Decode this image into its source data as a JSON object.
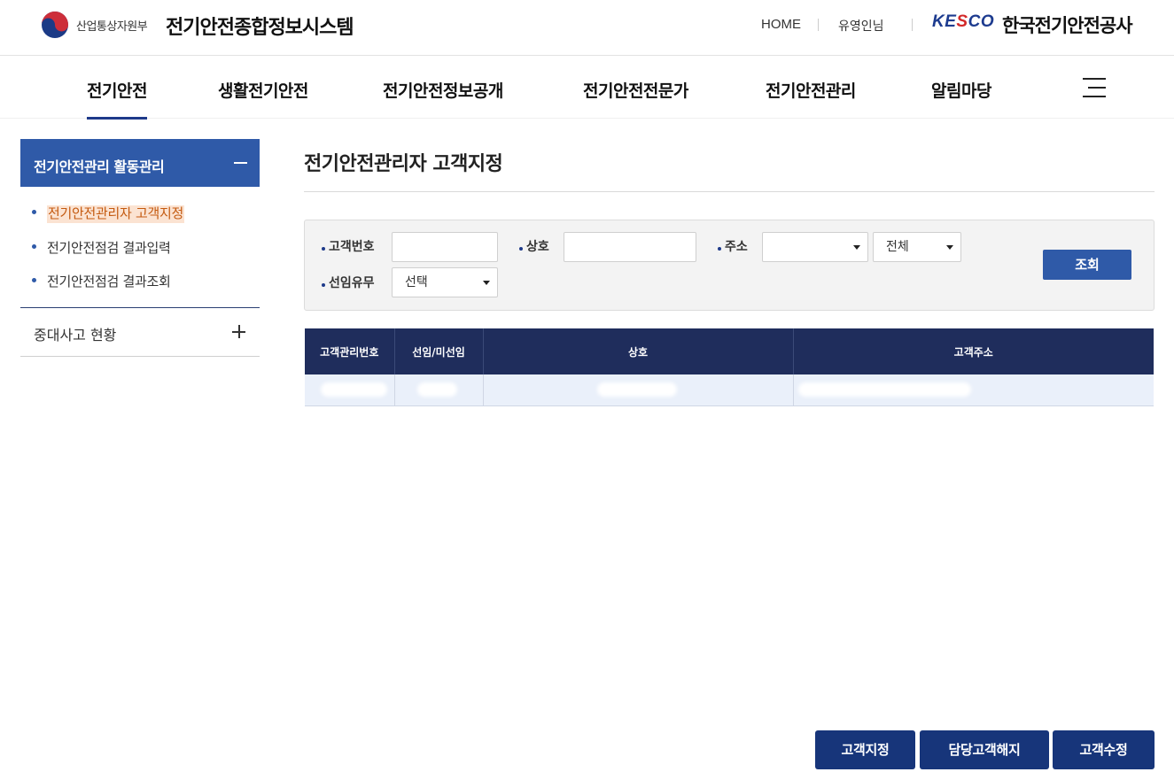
{
  "header": {
    "gov_name": "산업통상자원부",
    "system_title": "전기안전종합정보시스템",
    "home_link": "HOME",
    "user_name": "유영인님",
    "kesco_logo": "KESCO",
    "kesco_name": "한국전기안전공사",
    "brand_color": "#1e3a8a"
  },
  "gnb": {
    "items": [
      "전기안전",
      "생활전기안전",
      "전기안전정보공개",
      "전기안전전문가",
      "전기안전관리",
      "알림마당"
    ],
    "active_index": 0,
    "menu_icon": "hamburger-icon"
  },
  "sidebar": {
    "section_title": "전기안전관리 활동관리",
    "sub_items": [
      "전기안전관리자 고객지정",
      "전기안전점검 결과입력",
      "전기안전점검 결과조회"
    ],
    "active_sub_index": 0,
    "collapsed_item": "중대사고 현황"
  },
  "content": {
    "page_title": "전기안전관리자 고객지정"
  },
  "search": {
    "customer_no_label": "고객번호",
    "customer_no_value": "",
    "company_label": "상호",
    "company_value": "",
    "address_label": "주소",
    "address_select1": "",
    "address_select2": "전체",
    "appointed_label": "선임유무",
    "appointed_select": "선택",
    "search_button": "조회"
  },
  "table": {
    "headers": [
      "고객관리번호",
      "선임/미선임",
      "상호",
      "고객주소"
    ]
  },
  "actions": {
    "assign": "고객지정",
    "release": "담당고객해지",
    "edit": "고객수정"
  }
}
